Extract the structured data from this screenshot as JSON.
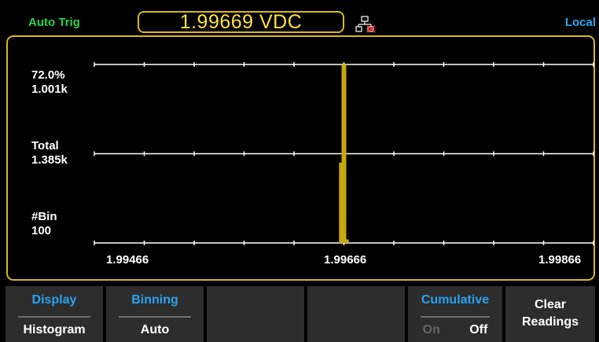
{
  "status_bar": {
    "trigger_mode": "Auto Trig",
    "reading": "1.99669 VDC",
    "remote_state": "Local",
    "network_icon": "network-disconnected-icon"
  },
  "histogram": {
    "y_labels": {
      "top": "72.0%\n1.001k",
      "mid": "Total\n1.385k",
      "bottom": "#Bin\n100"
    },
    "x_labels": [
      "1.99466",
      "1.99666",
      "1.99866"
    ]
  },
  "chart_data": {
    "type": "bar",
    "x": [
      1.99664,
      1.99666,
      1.99668
    ],
    "values": [
      0.45,
      1.0,
      0.02
    ],
    "xlim": [
      1.99466,
      1.99866
    ],
    "ylim": [
      0,
      1
    ],
    "bar_color": "#c7a80f",
    "grid": true
  },
  "softkeys": [
    {
      "title": "Display",
      "value": "Histogram"
    },
    {
      "title": "Binning",
      "value": "Auto"
    },
    {
      "title": "",
      "value": ""
    },
    {
      "title": "",
      "value": ""
    },
    {
      "title": "Cumulative",
      "options": [
        "On",
        "Off"
      ],
      "selected": "Off"
    },
    {
      "label": "Clear\nReadings"
    }
  ],
  "colors": {
    "accent_yellow": "#d9b81e",
    "readout_yellow": "#ffe23a",
    "trig_green": "#2bd24a",
    "local_blue": "#2aa6f2",
    "softkey_bg": "#2d2d2d"
  }
}
